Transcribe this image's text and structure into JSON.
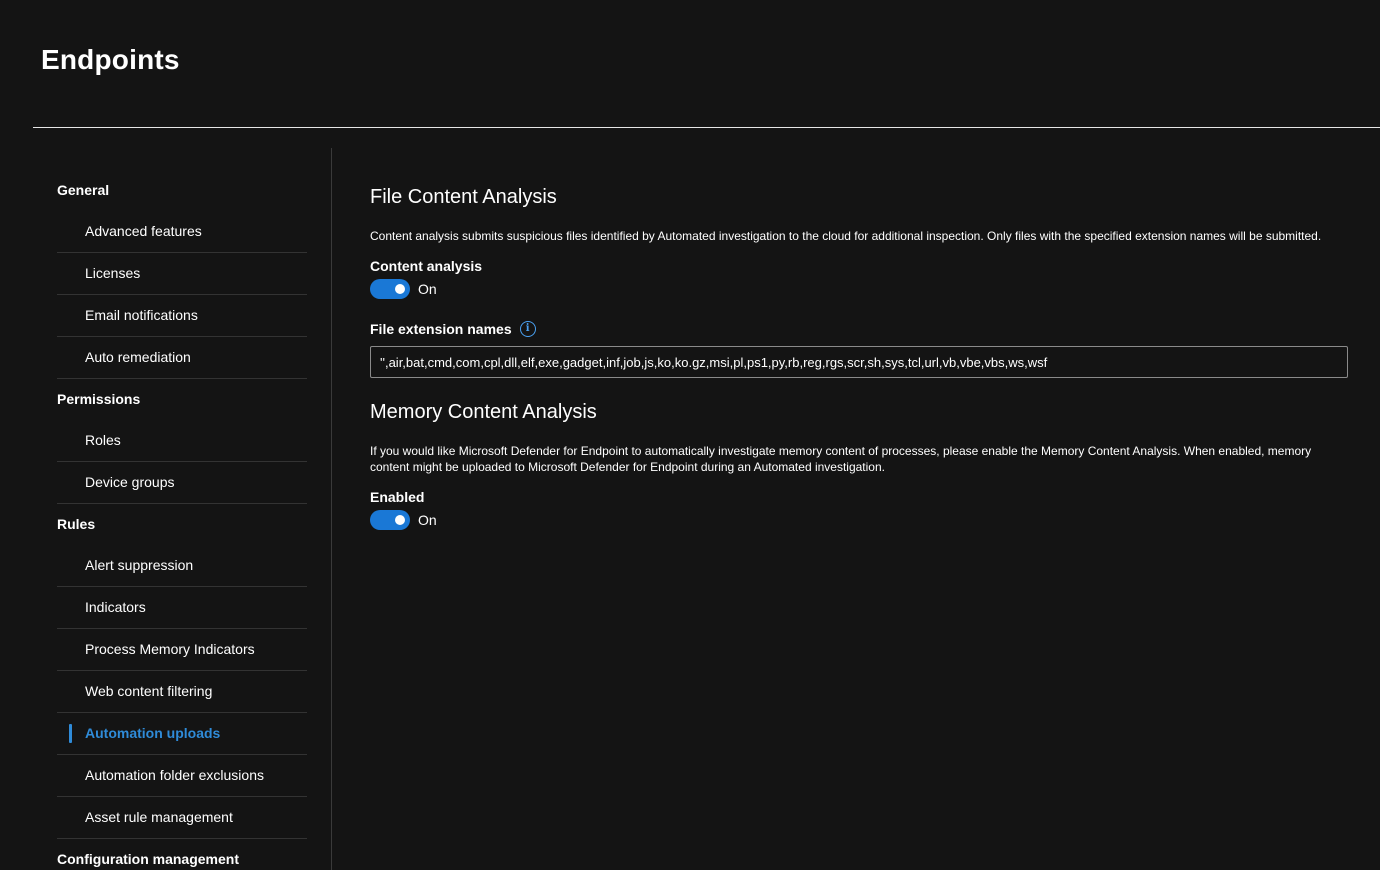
{
  "page": {
    "title": "Endpoints"
  },
  "sidebar": {
    "groups": [
      {
        "label": "General",
        "items": [
          "Advanced features",
          "Licenses",
          "Email notifications",
          "Auto remediation"
        ]
      },
      {
        "label": "Permissions",
        "items": [
          "Roles",
          "Device groups"
        ]
      },
      {
        "label": "Rules",
        "items": [
          "Alert suppression",
          "Indicators",
          "Process Memory Indicators",
          "Web content filtering",
          "Automation uploads",
          "Automation folder exclusions",
          "Asset rule management"
        ]
      },
      {
        "label": "Configuration management",
        "items": []
      }
    ],
    "active_item": "Automation uploads"
  },
  "file_content": {
    "title": "File Content Analysis",
    "description": "Content analysis submits suspicious files identified by Automated investigation to the cloud for additional inspection. Only files with the specified extension names will be submitted.",
    "toggle_label": "Content analysis",
    "toggle_state": "On",
    "extensions_label": "File extension names",
    "extensions_value": "'',air,bat,cmd,com,cpl,dll,elf,exe,gadget,inf,job,js,ko,ko.gz,msi,pl,ps1,py,rb,reg,rgs,scr,sh,sys,tcl,url,vb,vbe,vbs,ws,wsf"
  },
  "memory_content": {
    "title": "Memory Content Analysis",
    "description": "If you would like Microsoft Defender for Endpoint to automatically investigate memory content of processes, please enable the Memory Content Analysis. When enabled, memory content might be uploaded to Microsoft Defender for Endpoint during an Automated investigation.",
    "toggle_label": "Enabled",
    "toggle_state": "On"
  },
  "colors": {
    "accent": "#2f8bd8",
    "toggle_on": "#1a78d6",
    "background": "#141414"
  },
  "icons": {
    "info": "info-icon"
  }
}
